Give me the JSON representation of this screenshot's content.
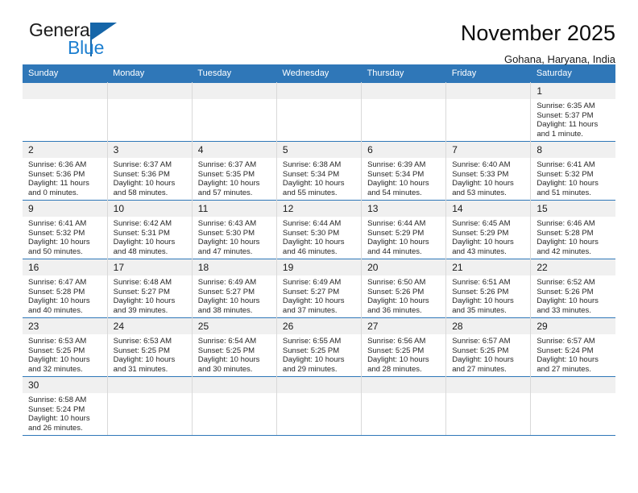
{
  "brand": {
    "name_top": "General",
    "name_bottom": "Blue",
    "accent_color": "#1d7fd0",
    "flag_color": "#1565a8"
  },
  "header": {
    "title": "November 2025",
    "subtitle": "Gohana, Haryana, India",
    "header_bg": "#2f77b8"
  },
  "calendar": {
    "weekday_headers": [
      "Sunday",
      "Monday",
      "Tuesday",
      "Wednesday",
      "Thursday",
      "Friday",
      "Saturday"
    ],
    "labels": {
      "sunrise": "Sunrise:",
      "sunset": "Sunset:",
      "daylight": "Daylight:"
    },
    "weeks": [
      [
        {
          "day": ""
        },
        {
          "day": ""
        },
        {
          "day": ""
        },
        {
          "day": ""
        },
        {
          "day": ""
        },
        {
          "day": ""
        },
        {
          "day": "1",
          "sunrise": "Sunrise: 6:35 AM",
          "sunset": "Sunset: 5:37 PM",
          "daylight": "Daylight: 11 hours and 1 minute."
        }
      ],
      [
        {
          "day": "2",
          "sunrise": "Sunrise: 6:36 AM",
          "sunset": "Sunset: 5:36 PM",
          "daylight": "Daylight: 11 hours and 0 minutes."
        },
        {
          "day": "3",
          "sunrise": "Sunrise: 6:37 AM",
          "sunset": "Sunset: 5:36 PM",
          "daylight": "Daylight: 10 hours and 58 minutes."
        },
        {
          "day": "4",
          "sunrise": "Sunrise: 6:37 AM",
          "sunset": "Sunset: 5:35 PM",
          "daylight": "Daylight: 10 hours and 57 minutes."
        },
        {
          "day": "5",
          "sunrise": "Sunrise: 6:38 AM",
          "sunset": "Sunset: 5:34 PM",
          "daylight": "Daylight: 10 hours and 55 minutes."
        },
        {
          "day": "6",
          "sunrise": "Sunrise: 6:39 AM",
          "sunset": "Sunset: 5:34 PM",
          "daylight": "Daylight: 10 hours and 54 minutes."
        },
        {
          "day": "7",
          "sunrise": "Sunrise: 6:40 AM",
          "sunset": "Sunset: 5:33 PM",
          "daylight": "Daylight: 10 hours and 53 minutes."
        },
        {
          "day": "8",
          "sunrise": "Sunrise: 6:41 AM",
          "sunset": "Sunset: 5:32 PM",
          "daylight": "Daylight: 10 hours and 51 minutes."
        }
      ],
      [
        {
          "day": "9",
          "sunrise": "Sunrise: 6:41 AM",
          "sunset": "Sunset: 5:32 PM",
          "daylight": "Daylight: 10 hours and 50 minutes."
        },
        {
          "day": "10",
          "sunrise": "Sunrise: 6:42 AM",
          "sunset": "Sunset: 5:31 PM",
          "daylight": "Daylight: 10 hours and 48 minutes."
        },
        {
          "day": "11",
          "sunrise": "Sunrise: 6:43 AM",
          "sunset": "Sunset: 5:30 PM",
          "daylight": "Daylight: 10 hours and 47 minutes."
        },
        {
          "day": "12",
          "sunrise": "Sunrise: 6:44 AM",
          "sunset": "Sunset: 5:30 PM",
          "daylight": "Daylight: 10 hours and 46 minutes."
        },
        {
          "day": "13",
          "sunrise": "Sunrise: 6:44 AM",
          "sunset": "Sunset: 5:29 PM",
          "daylight": "Daylight: 10 hours and 44 minutes."
        },
        {
          "day": "14",
          "sunrise": "Sunrise: 6:45 AM",
          "sunset": "Sunset: 5:29 PM",
          "daylight": "Daylight: 10 hours and 43 minutes."
        },
        {
          "day": "15",
          "sunrise": "Sunrise: 6:46 AM",
          "sunset": "Sunset: 5:28 PM",
          "daylight": "Daylight: 10 hours and 42 minutes."
        }
      ],
      [
        {
          "day": "16",
          "sunrise": "Sunrise: 6:47 AM",
          "sunset": "Sunset: 5:28 PM",
          "daylight": "Daylight: 10 hours and 40 minutes."
        },
        {
          "day": "17",
          "sunrise": "Sunrise: 6:48 AM",
          "sunset": "Sunset: 5:27 PM",
          "daylight": "Daylight: 10 hours and 39 minutes."
        },
        {
          "day": "18",
          "sunrise": "Sunrise: 6:49 AM",
          "sunset": "Sunset: 5:27 PM",
          "daylight": "Daylight: 10 hours and 38 minutes."
        },
        {
          "day": "19",
          "sunrise": "Sunrise: 6:49 AM",
          "sunset": "Sunset: 5:27 PM",
          "daylight": "Daylight: 10 hours and 37 minutes."
        },
        {
          "day": "20",
          "sunrise": "Sunrise: 6:50 AM",
          "sunset": "Sunset: 5:26 PM",
          "daylight": "Daylight: 10 hours and 36 minutes."
        },
        {
          "day": "21",
          "sunrise": "Sunrise: 6:51 AM",
          "sunset": "Sunset: 5:26 PM",
          "daylight": "Daylight: 10 hours and 35 minutes."
        },
        {
          "day": "22",
          "sunrise": "Sunrise: 6:52 AM",
          "sunset": "Sunset: 5:26 PM",
          "daylight": "Daylight: 10 hours and 33 minutes."
        }
      ],
      [
        {
          "day": "23",
          "sunrise": "Sunrise: 6:53 AM",
          "sunset": "Sunset: 5:25 PM",
          "daylight": "Daylight: 10 hours and 32 minutes."
        },
        {
          "day": "24",
          "sunrise": "Sunrise: 6:53 AM",
          "sunset": "Sunset: 5:25 PM",
          "daylight": "Daylight: 10 hours and 31 minutes."
        },
        {
          "day": "25",
          "sunrise": "Sunrise: 6:54 AM",
          "sunset": "Sunset: 5:25 PM",
          "daylight": "Daylight: 10 hours and 30 minutes."
        },
        {
          "day": "26",
          "sunrise": "Sunrise: 6:55 AM",
          "sunset": "Sunset: 5:25 PM",
          "daylight": "Daylight: 10 hours and 29 minutes."
        },
        {
          "day": "27",
          "sunrise": "Sunrise: 6:56 AM",
          "sunset": "Sunset: 5:25 PM",
          "daylight": "Daylight: 10 hours and 28 minutes."
        },
        {
          "day": "28",
          "sunrise": "Sunrise: 6:57 AM",
          "sunset": "Sunset: 5:25 PM",
          "daylight": "Daylight: 10 hours and 27 minutes."
        },
        {
          "day": "29",
          "sunrise": "Sunrise: 6:57 AM",
          "sunset": "Sunset: 5:24 PM",
          "daylight": "Daylight: 10 hours and 27 minutes."
        }
      ],
      [
        {
          "day": "30",
          "sunrise": "Sunrise: 6:58 AM",
          "sunset": "Sunset: 5:24 PM",
          "daylight": "Daylight: 10 hours and 26 minutes."
        },
        {
          "day": ""
        },
        {
          "day": ""
        },
        {
          "day": ""
        },
        {
          "day": ""
        },
        {
          "day": ""
        },
        {
          "day": ""
        }
      ]
    ]
  }
}
